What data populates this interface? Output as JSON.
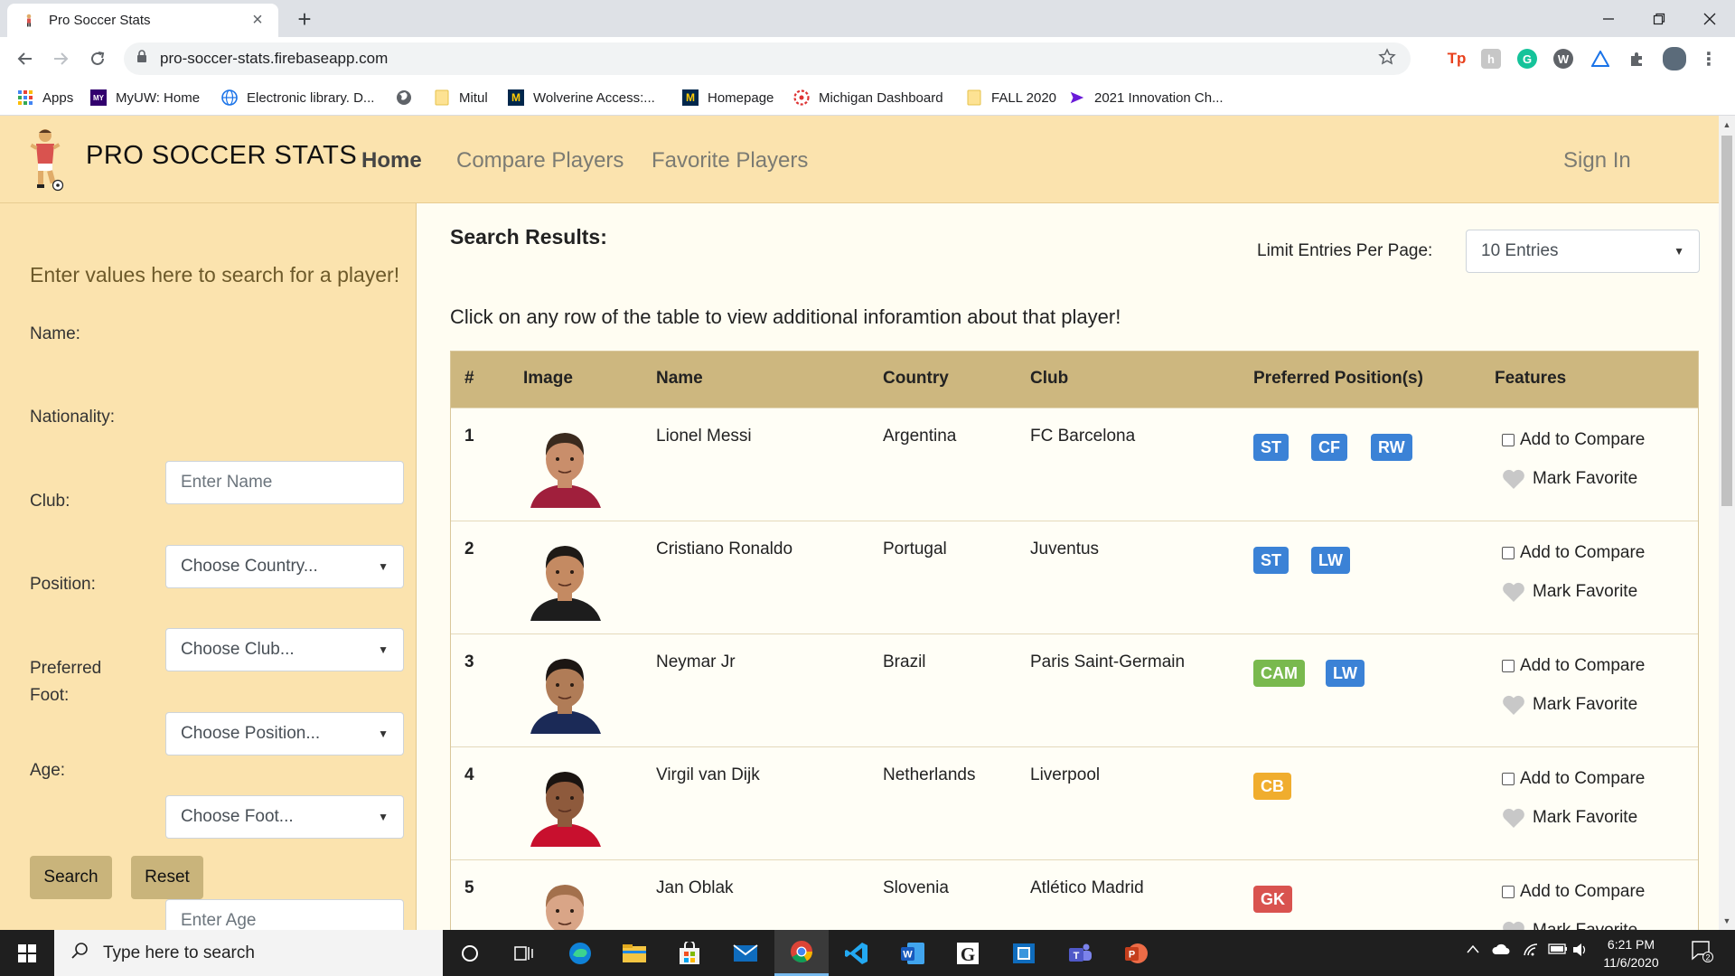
{
  "browser": {
    "tab_title": "Pro Soccer Stats",
    "url": "pro-soccer-stats.firebaseapp.com",
    "bookmarks": [
      {
        "label": "Apps",
        "icon": "apps-grid-icon"
      },
      {
        "label": "MyUW: Home",
        "icon": "myuw-icon"
      },
      {
        "label": "Electronic library. D...",
        "icon": "globe-icon"
      },
      {
        "label": "",
        "icon": "world-icon"
      },
      {
        "label": "Mitul",
        "icon": "folder-icon"
      },
      {
        "label": "Wolverine Access:...",
        "icon": "umich-icon"
      },
      {
        "label": "Homepage",
        "icon": "umich-block-m-icon"
      },
      {
        "label": "Michigan Dashboard",
        "icon": "dashboard-icon"
      },
      {
        "label": "FALL 2020",
        "icon": "folder-icon"
      },
      {
        "label": "2021 Innovation Ch...",
        "icon": "chevron-logo-icon"
      }
    ]
  },
  "site": {
    "brand": "PRO SOCCER STATS",
    "nav": {
      "home": "Home",
      "compare": "Compare Players",
      "favorites": "Favorite Players",
      "sign_in": "Sign In"
    }
  },
  "sidebar": {
    "heading": "Enter values here to search for a player!",
    "name_label": "Name:",
    "name_placeholder": "Enter Name",
    "nationality_label": "Nationality:",
    "nationality_value": "Choose Country...",
    "club_label": "Club:",
    "club_value": "Choose Club...",
    "position_label": "Position:",
    "position_value": "Choose Position...",
    "foot_label_1": "Preferred",
    "foot_label_2": "Foot:",
    "foot_value": "Choose Foot...",
    "age_label": "Age:",
    "age_placeholder": "Enter Age",
    "search_button": "Search",
    "reset_button": "Reset"
  },
  "results": {
    "title": "Search Results:",
    "limit_label": "Limit Entries Per Page:",
    "limit_value": "10 Entries",
    "instruction": "Click on any row of the table to view additional inforamtion about that player!",
    "columns": [
      "#",
      "Image",
      "Name",
      "Country",
      "Club",
      "Preferred Position(s)",
      "Features"
    ],
    "compare_label": "Add to Compare",
    "favorite_label": "Mark Favorite",
    "rows": [
      {
        "num": "1",
        "name": "Lionel Messi",
        "country": "Argentina",
        "club": "FC Barcelona",
        "positions": [
          {
            "code": "ST",
            "color": "#3b82d6"
          },
          {
            "code": "CF",
            "color": "#3b82d6"
          },
          {
            "code": "RW",
            "color": "#3b82d6"
          }
        ],
        "skin": "#c98e6b",
        "hair": "#3a2a1e",
        "kit": "#a01f3c"
      },
      {
        "num": "2",
        "name": "Cristiano Ronaldo",
        "country": "Portugal",
        "club": "Juventus",
        "positions": [
          {
            "code": "ST",
            "color": "#3b82d6"
          },
          {
            "code": "LW",
            "color": "#3b82d6"
          }
        ],
        "skin": "#c48a62",
        "hair": "#1e1a16",
        "kit": "#1d1d1d"
      },
      {
        "num": "3",
        "name": "Neymar Jr",
        "country": "Brazil",
        "club": "Paris Saint-Germain",
        "positions": [
          {
            "code": "CAM",
            "color": "#79b94e"
          },
          {
            "code": "LW",
            "color": "#3b82d6"
          }
        ],
        "skin": "#b07c57",
        "hair": "#1c1613",
        "kit": "#1b2a57"
      },
      {
        "num": "4",
        "name": "Virgil van Dijk",
        "country": "Netherlands",
        "club": "Liverpool",
        "positions": [
          {
            "code": "CB",
            "color": "#f0ad2e"
          }
        ],
        "skin": "#8e5a3c",
        "hair": "#1a1411",
        "kit": "#c8102e"
      },
      {
        "num": "5",
        "name": "Jan Oblak",
        "country": "Slovenia",
        "club": "Atlético Madrid",
        "positions": [
          {
            "code": "GK",
            "color": "#d9534f"
          }
        ],
        "skin": "#d9a587",
        "hair": "#a3704c",
        "kit": "#c0392b"
      }
    ]
  },
  "taskbar": {
    "search_placeholder": "Type here to search",
    "time": "6:21 PM",
    "date": "11/6/2020",
    "notifications": "2"
  }
}
